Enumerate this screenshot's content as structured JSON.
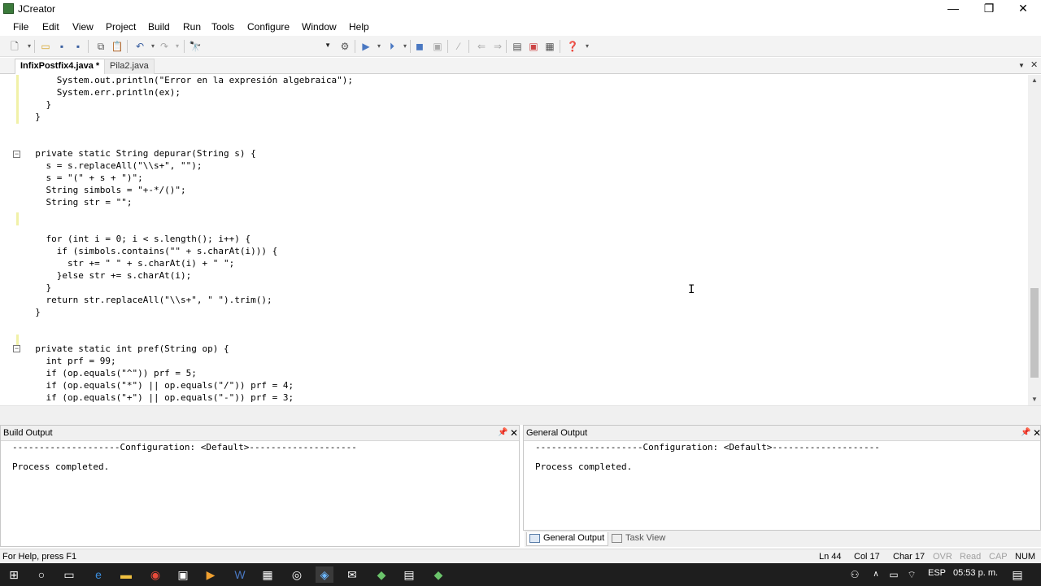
{
  "window": {
    "title": "JCreator",
    "minimize_glyph": "—",
    "maximize_glyph": "❐",
    "close_glyph": "✕"
  },
  "menu": [
    "File",
    "Edit",
    "View",
    "Project",
    "Build",
    "Run",
    "Tools",
    "Configure",
    "Window",
    "Help"
  ],
  "toolbar": {
    "icons": [
      "new-file-icon",
      "open-icon",
      "save-icon",
      "save-all-icon",
      "copy-icon",
      "paste-icon",
      "undo-icon",
      "redo-icon",
      "find-icon",
      "config-combo",
      "compile-icon",
      "run-icon",
      "debug-icon",
      "stop-icon",
      "step-icon",
      "back-icon",
      "forward-icon",
      "window-icon",
      "window-close-icon",
      "window-all-icon",
      "help-icon"
    ],
    "combo_value": ""
  },
  "tabs": [
    {
      "label": "InfixPostfix4.java *",
      "active": true
    },
    {
      "label": "Pila2.java",
      "active": false
    }
  ],
  "editor": {
    "lines": [
      "      System.out.println(\"Error en la expresión algebraica\");",
      "      System.err.println(ex);",
      "    }",
      "  }",
      "",
      "",
      "  private static String depurar(String s) {",
      "    s = s.replaceAll(\"\\\\s+\", \"\");",
      "    s = \"(\" + s + \")\";",
      "    String simbols = \"+-*/()\";",
      "    String str = \"\";",
      "",
      "",
      "    for (int i = 0; i < s.length(); i++) {",
      "      if (simbols.contains(\"\" + s.charAt(i))) {",
      "        str += \" \" + s.charAt(i) + \" \";",
      "      }else str += s.charAt(i);",
      "    }",
      "    return str.replaceAll(\"\\\\s+\", \" \").trim();",
      "  }",
      "",
      "",
      "  private static int pref(String op) {",
      "    int prf = 99;",
      "    if (op.equals(\"^\")) prf = 5;",
      "    if (op.equals(\"*\") || op.equals(\"/\")) prf = 4;",
      "    if (op.equals(\"+\") || op.equals(\"-\")) prf = 3;"
    ]
  },
  "panels": {
    "build_output": {
      "title": "Build Output",
      "config_line": "--------------------Configuration: <Default>--------------------",
      "result": "Process completed."
    },
    "general_output": {
      "title": "General Output",
      "config_line": "--------------------Configuration: <Default>--------------------",
      "result": "Process completed."
    },
    "bottom_tabs": [
      "General Output",
      "Task View"
    ]
  },
  "status": {
    "help": "For Help, press F1",
    "line": "Ln 44",
    "col": "Col 17",
    "char": "Char 17",
    "ovr": "OVR",
    "read": "Read",
    "cap": "CAP",
    "num": "NUM"
  },
  "taskbar": {
    "lang": "ESP",
    "time": "05:53 p. m."
  }
}
